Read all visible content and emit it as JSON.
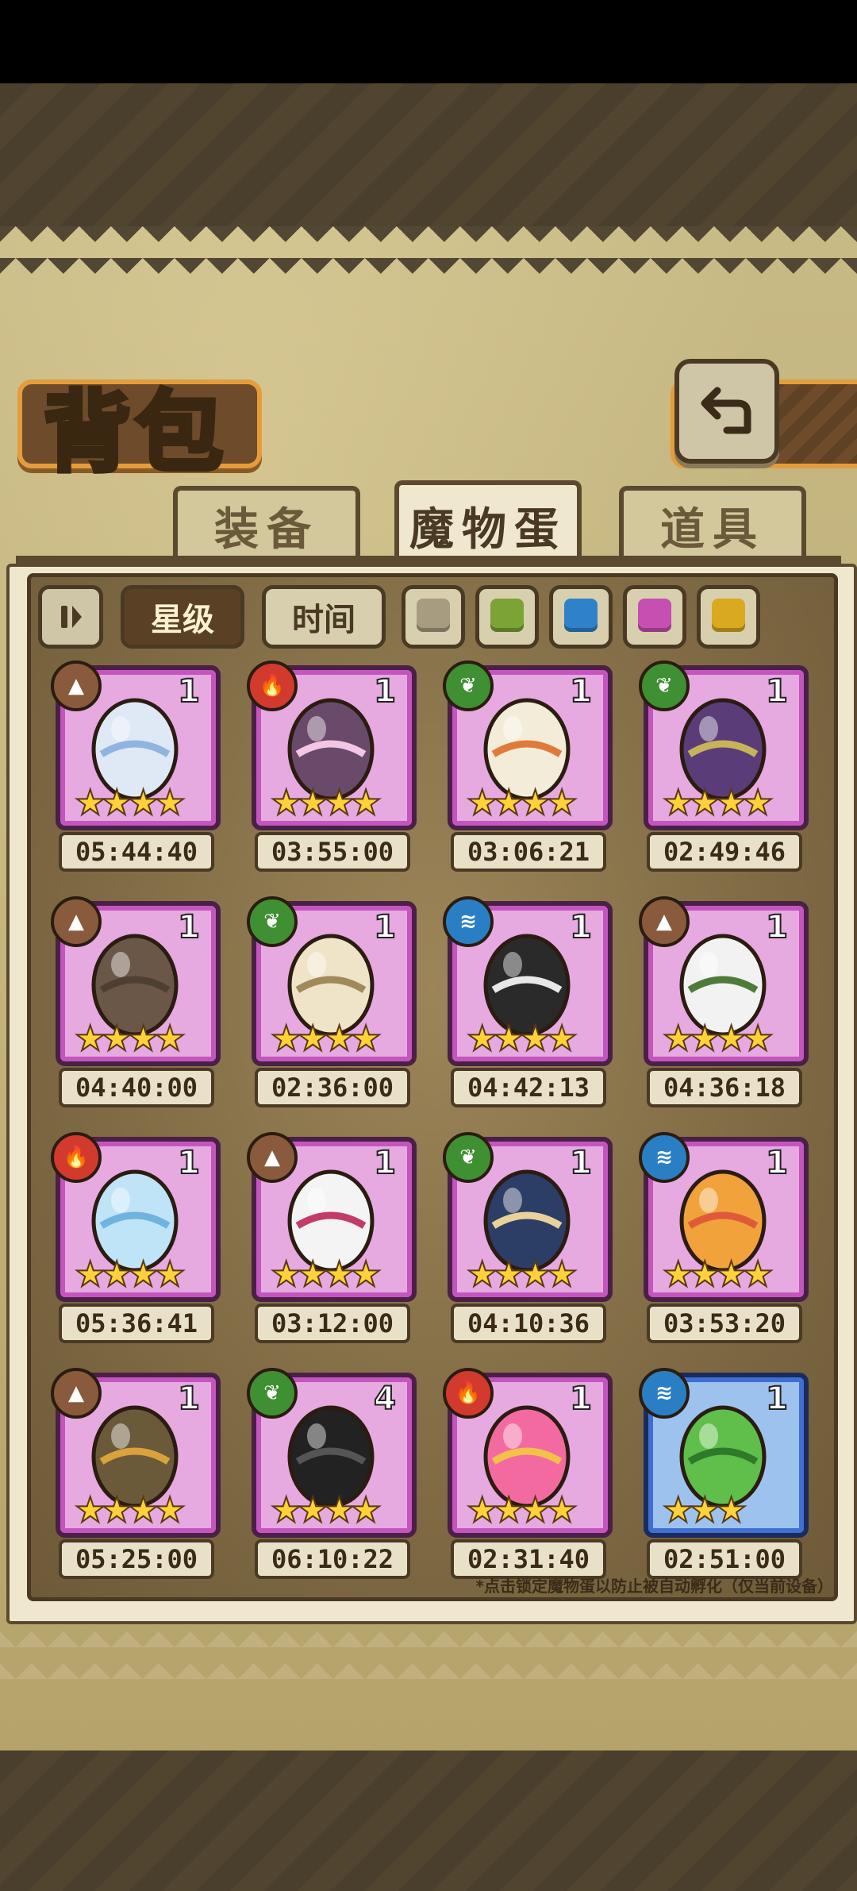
{
  "title": "背包",
  "tabs": [
    {
      "label": "装备",
      "active": false
    },
    {
      "label": "魔物蛋",
      "active": true
    },
    {
      "label": "道具",
      "active": false
    }
  ],
  "sort": {
    "toggle_icon": "pause-sort-icon",
    "star_label": "星级",
    "time_label": "时间"
  },
  "color_filters": [
    "#a79c7f",
    "#7ca335",
    "#2f82c8",
    "#c64fb1",
    "#d9a91f"
  ],
  "eggs": [
    {
      "element": "earth",
      "count": "1",
      "stars": "★★★★",
      "timer": "05:44:40",
      "rarity": "purple"
    },
    {
      "element": "fire",
      "count": "1",
      "stars": "★★★★",
      "timer": "03:55:00",
      "rarity": "purple"
    },
    {
      "element": "nature",
      "count": "1",
      "stars": "★★★★",
      "timer": "03:06:21",
      "rarity": "purple"
    },
    {
      "element": "nature",
      "count": "1",
      "stars": "★★★★",
      "timer": "02:49:46",
      "rarity": "purple"
    },
    {
      "element": "earth",
      "count": "1",
      "stars": "★★★★",
      "timer": "04:40:00",
      "rarity": "purple"
    },
    {
      "element": "nature",
      "count": "1",
      "stars": "★★★★",
      "timer": "02:36:00",
      "rarity": "purple"
    },
    {
      "element": "water",
      "count": "1",
      "stars": "★★★★",
      "timer": "04:42:13",
      "rarity": "purple"
    },
    {
      "element": "earth",
      "count": "1",
      "stars": "★★★★",
      "timer": "04:36:18",
      "rarity": "purple"
    },
    {
      "element": "fire",
      "count": "1",
      "stars": "★★★★",
      "timer": "05:36:41",
      "rarity": "purple"
    },
    {
      "element": "earth",
      "count": "1",
      "stars": "★★★★",
      "timer": "03:12:00",
      "rarity": "purple"
    },
    {
      "element": "nature",
      "count": "1",
      "stars": "★★★★",
      "timer": "04:10:36",
      "rarity": "purple"
    },
    {
      "element": "water",
      "count": "1",
      "stars": "★★★★",
      "timer": "03:53:20",
      "rarity": "purple"
    },
    {
      "element": "earth",
      "count": "1",
      "stars": "★★★★",
      "timer": "05:25:00",
      "rarity": "purple"
    },
    {
      "element": "nature",
      "count": "4",
      "stars": "★★★★",
      "timer": "06:10:22",
      "rarity": "purple"
    },
    {
      "element": "fire",
      "count": "1",
      "stars": "★★★★",
      "timer": "02:31:40",
      "rarity": "purple"
    },
    {
      "element": "water",
      "count": "1",
      "stars": "★★★",
      "timer": "02:51:00",
      "rarity": "blue"
    }
  ],
  "element_colors": {
    "earth": "#8a5a3c",
    "fire": "#d23a2e",
    "nature": "#3f8f33",
    "water": "#2a7fc4"
  },
  "footnote": "*点击锁定魔物蛋以防止被自动孵化（仅当前设备）"
}
